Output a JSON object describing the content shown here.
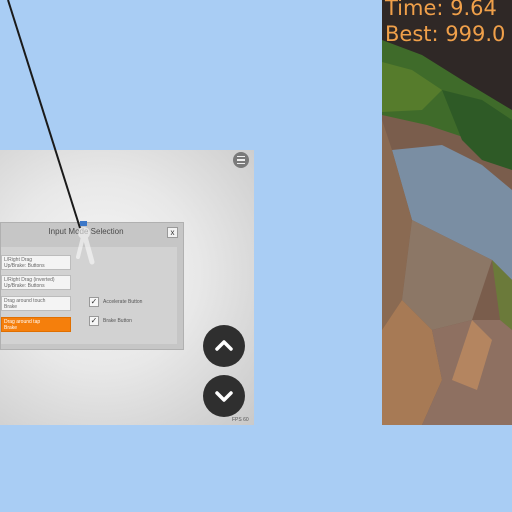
{
  "input_dialog": {
    "title": "Input Mode Selection",
    "close_label": "x",
    "options": [
      {
        "line1": "L/Right Drag",
        "line2": "Up/Brake: Buttons",
        "selected": false
      },
      {
        "line1": "L/Right Drag (inverted)",
        "line2": "Up/Brake: Buttons",
        "selected": false
      },
      {
        "line1": "Drag around touch",
        "line2": "Brake",
        "selected": false
      },
      {
        "line1": "Drag around tap",
        "line2": "Brake",
        "selected": true
      }
    ],
    "checkboxes": [
      {
        "label": "Accelerate Button",
        "checked": true,
        "mark": "✓"
      },
      {
        "label": "Brake Button",
        "checked": true,
        "mark": "✓"
      }
    ]
  },
  "controls": {
    "up_icon": "chevron-up-icon",
    "down_icon": "chevron-down-icon"
  },
  "fps_text": "FPS 60",
  "hud": {
    "time_text": "Time: 9.64",
    "best_text": "Best: 999.0"
  },
  "colors": {
    "background": "#a9cdf4",
    "accent_orange": "#f57f0c",
    "hud_text": "#f0a04a",
    "button_dark": "#2f2f2f"
  }
}
